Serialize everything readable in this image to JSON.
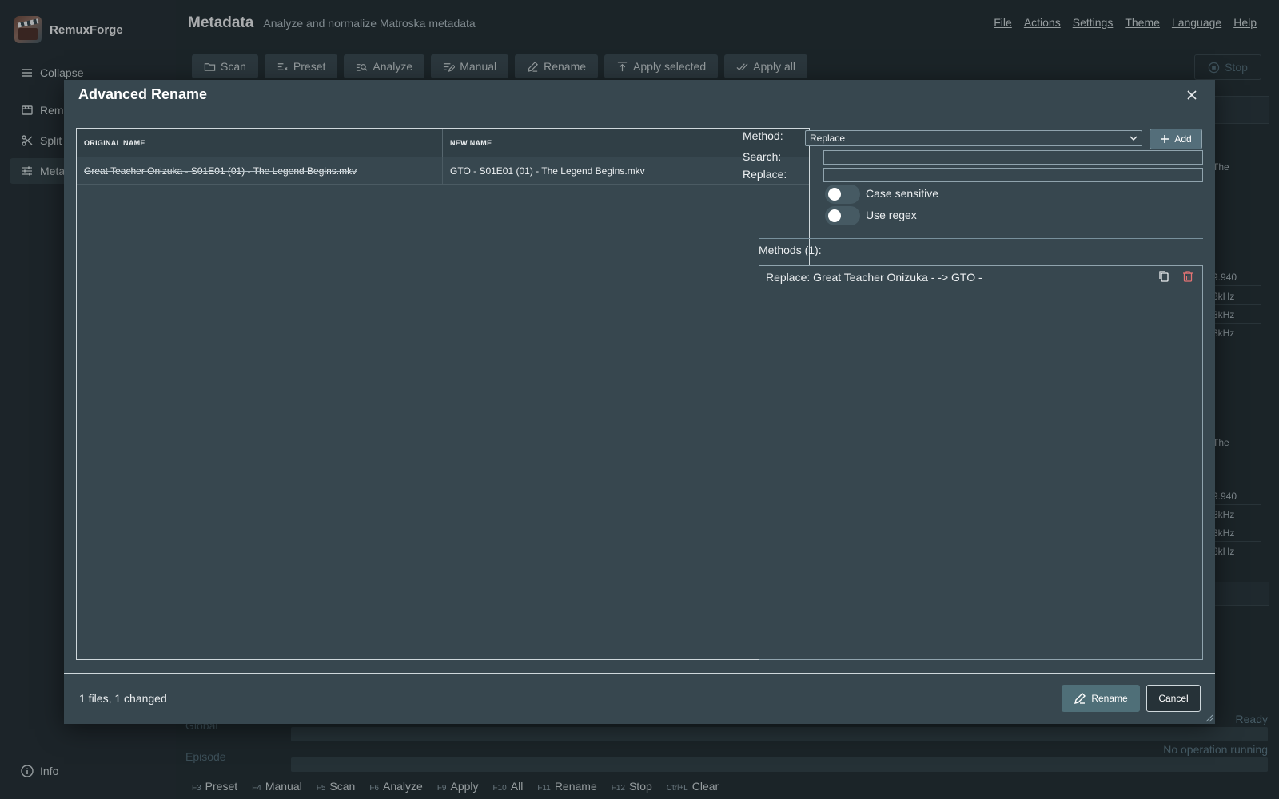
{
  "app": {
    "name": "RemuxForge",
    "sidebar": {
      "collapse_label": "Collapse",
      "items": [
        {
          "label": "Remu",
          "icon": "film-icon"
        },
        {
          "label": "Split",
          "icon": "scissors-icon"
        },
        {
          "label": "Meta",
          "icon": "sliders-icon"
        }
      ],
      "info_label": "Info"
    },
    "header": {
      "title": "Metadata",
      "subtitle": "Analyze and normalize Matroska metadata"
    },
    "menu": [
      "File",
      "Actions",
      "Settings",
      "Theme",
      "Language",
      "Help"
    ],
    "toolbar": [
      {
        "label": "Scan",
        "icon": "folder-icon"
      },
      {
        "label": "Preset",
        "icon": "preset-icon"
      },
      {
        "label": "Analyze",
        "icon": "analyze-icon"
      },
      {
        "label": "Manual",
        "icon": "edit-list-icon"
      },
      {
        "label": "Rename",
        "icon": "pencil-icon"
      },
      {
        "label": "Apply selected",
        "icon": "upload-icon"
      },
      {
        "label": "Apply all",
        "icon": "check-all-icon"
      }
    ],
    "stop_label": "Stop",
    "background_cells": [
      "The",
      "9.940",
      "8kHz",
      "8kHz",
      "8kHz",
      "The",
      "9.940",
      "8kHz",
      "8kHz",
      "8kHz"
    ],
    "progress": {
      "global_label": "Global",
      "episode_label": "Episode",
      "global_status": "Ready",
      "episode_status": "No operation running"
    },
    "shortcuts": [
      {
        "key": "F3",
        "label": "Preset"
      },
      {
        "key": "F4",
        "label": "Manual"
      },
      {
        "key": "F5",
        "label": "Scan"
      },
      {
        "key": "F6",
        "label": "Analyze"
      },
      {
        "key": "F9",
        "label": "Apply"
      },
      {
        "key": "F10",
        "label": "All"
      },
      {
        "key": "F11",
        "label": "Rename"
      },
      {
        "key": "F12",
        "label": "Stop"
      },
      {
        "key": "Ctrl+L",
        "label": "Clear"
      }
    ]
  },
  "dialog": {
    "title": "Advanced Rename",
    "table": {
      "headers": [
        "ORIGINAL NAME",
        "NEW NAME"
      ],
      "rows": [
        {
          "original": "Great Teacher Onizuka - S01E01 (01) - The Legend Begins.mkv",
          "new": "GTO - S01E01 (01) - The Legend Begins.mkv"
        }
      ]
    },
    "method_label": "Method:",
    "method_value": "Replace",
    "add_label": "Add",
    "search_label": "Search:",
    "search_value": "",
    "replace_label": "Replace:",
    "replace_value": "",
    "case_sensitive_label": "Case sensitive",
    "case_sensitive_on": false,
    "use_regex_label": "Use regex",
    "use_regex_on": false,
    "methods_title": "Methods (1):",
    "methods": [
      "Replace: Great Teacher Onizuka - -> GTO -"
    ],
    "status": "1 files, 1 changed",
    "rename_label": "Rename",
    "cancel_label": "Cancel"
  }
}
